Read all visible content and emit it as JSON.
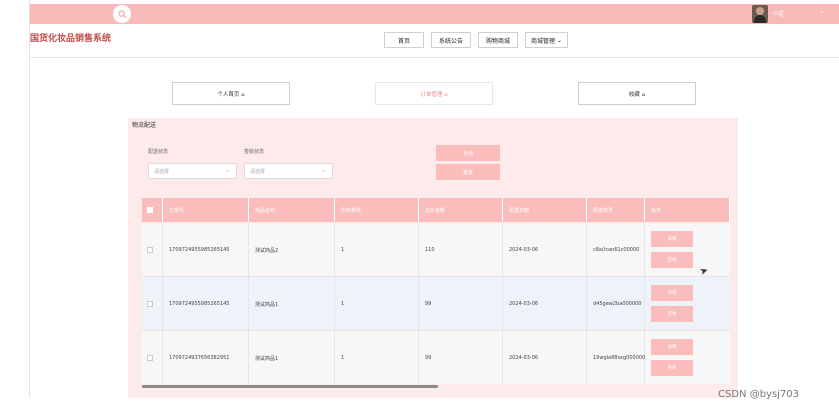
{
  "topbar": {
    "search_icon": "search-icon",
    "user_name": "小花",
    "user_caret": "⌄"
  },
  "app": {
    "title": "国货化妆品销售系统"
  },
  "nav": {
    "items": [
      {
        "label": "首页"
      },
      {
        "label": "系统公告"
      },
      {
        "label": "购物商城"
      },
      {
        "label": "商城管理"
      }
    ],
    "dropdown_caret": "⌄"
  },
  "profile_nav": {
    "items": [
      {
        "label": "个人首页 ⌂"
      },
      {
        "label": "订单管理 ⌂"
      },
      {
        "label": "收藏 ⌂"
      }
    ]
  },
  "panel": {
    "title": "物流配送",
    "filters": [
      {
        "label": "配送状态",
        "placeholder": "请选择"
      },
      {
        "label": "签收状态",
        "placeholder": "请选择"
      }
    ],
    "query_button": "查询",
    "reset_button": "重置"
  },
  "table": {
    "headers": [
      "订单号",
      "商品名称",
      "购买数量",
      "总价金额",
      "配送日期",
      "配送单号",
      "操作"
    ],
    "rows": [
      {
        "order_no": "1709724955985265145",
        "product": "测试商品2",
        "qty": "1",
        "total": "110",
        "date": "2024-03-06",
        "tracking": "c8a(ican61c00000",
        "btn1": "详情",
        "btn2": "签收"
      },
      {
        "order_no": "1709724955985265145",
        "product": "测试商品1",
        "qty": "1",
        "total": "99",
        "date": "2024-03-06",
        "tracking": "d45gew2ba000000",
        "btn1": "详情",
        "btn2": "签收"
      },
      {
        "order_no": "1709724937656382951",
        "product": "测试商品1",
        "qty": "1",
        "total": "99",
        "date": "2024-03-06",
        "tracking": "19wgla88sxg000000",
        "btn1": "详情",
        "btn2": "签收"
      }
    ]
  },
  "watermark": "CSDN @bysj703",
  "colors": {
    "accent": "#fbbcbc",
    "topbar": "#f8b9b9",
    "panel": "#fdeaea",
    "logo": "#c0504d"
  }
}
